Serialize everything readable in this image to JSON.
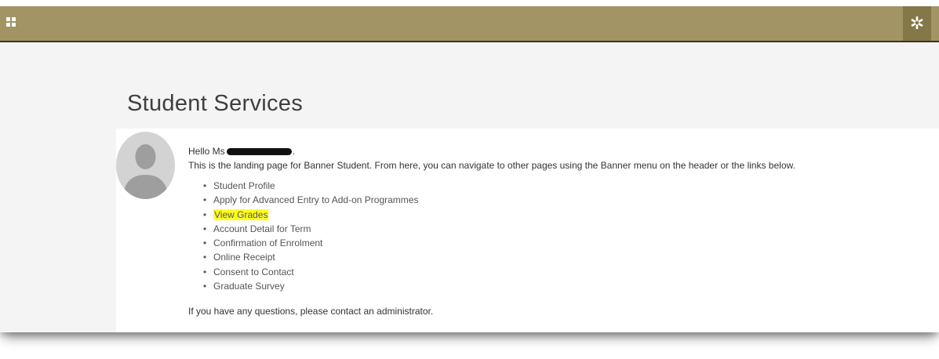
{
  "header": {
    "app_menu_icon": "grid-icon",
    "settings_icon": "gear-icon",
    "settings_glyph": "✲",
    "background_color": "#a29465"
  },
  "page": {
    "title": "Student Services"
  },
  "greeting": {
    "hello_prefix": "Hello Ms",
    "hello_suffix": ".",
    "intro": "This is the landing page for Banner Student. From here, you can navigate to other pages using the Banner menu on the header or the links below."
  },
  "links": [
    {
      "label": "Student Profile",
      "highlighted": false
    },
    {
      "label": "Apply for Advanced Entry to Add-on Programmes",
      "highlighted": false
    },
    {
      "label": "View Grades",
      "highlighted": true
    },
    {
      "label": "Account Detail for Term",
      "highlighted": false
    },
    {
      "label": "Confirmation of Enrolment",
      "highlighted": false
    },
    {
      "label": "Online Receipt",
      "highlighted": false
    },
    {
      "label": "Consent to Contact",
      "highlighted": false
    },
    {
      "label": "Graduate Survey",
      "highlighted": false
    }
  ],
  "footer": {
    "note": "If you have any questions, please contact an administrator."
  },
  "colors": {
    "highlight": "#ffff20",
    "title_text": "#3f3f3f"
  }
}
